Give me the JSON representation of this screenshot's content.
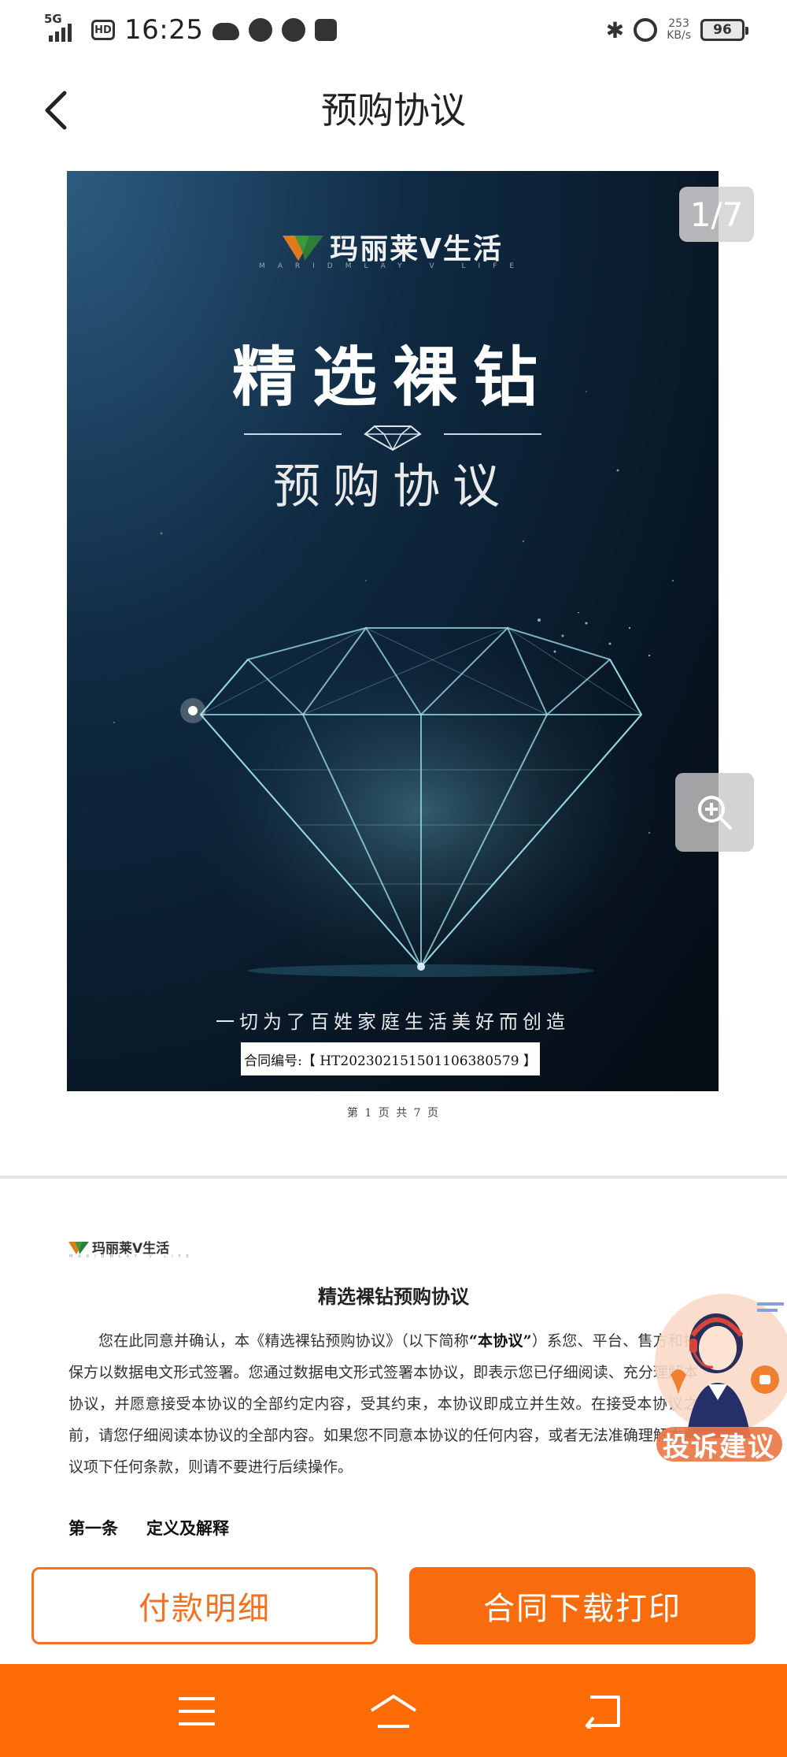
{
  "status_bar": {
    "network": "5G",
    "hd": "HD",
    "time": "16:25",
    "speed_value": "253",
    "speed_unit": "KB/s",
    "battery": "96",
    "icons": [
      "signal-icon",
      "weather-icon",
      "app-icon",
      "app-icon",
      "message-icon",
      "bluetooth-icon",
      "alarm-icon",
      "battery-icon"
    ]
  },
  "nav": {
    "title": "预购协议",
    "back_icon": "chevron-left-icon"
  },
  "cover": {
    "brand": "玛丽莱V生活",
    "brand_sub": "MARIDMLAY V LIFE",
    "title": "精选裸钻",
    "subtitle": "预购协议",
    "slogan": "一切为了百姓家庭生活美好而创造",
    "contract_label": "合同编号:【 HT2023021515011063805​79 】"
  },
  "viewer": {
    "page_indicator": "1/7",
    "page_footer": "第 1 页 共 7 页",
    "zoom_icon": "zoom-in-icon"
  },
  "page2": {
    "logo_text": "玛丽莱V生活",
    "logo_sub": "MARIDMLAY V LIFE",
    "title": "精选裸钻预购协议",
    "body_pre": "您在此同意并确认，本《精选裸钻预购协议》（以下简称",
    "body_bold": "“本协议”",
    "body_post": "）系您、平台、售方和担保方以数据电文形式签署。您通过数据电文形式签署本协议，即表示您已仔细阅读、充分理解本协议，并愿意接受本协议的全部约定内容，受其约束，本协议即成立并生效。在接受本协议之前，请您仔细阅读本协议的全部内容。如果您不同意本协议的任何内容，或者无法准确理解本协议项下任何条款，则请不要进行后续操作。",
    "section_num": "第一条",
    "section_title": "定义及解释"
  },
  "complaint": {
    "label": "投诉建议"
  },
  "actions": {
    "payment_details": "付款明细",
    "download_print": "合同下载打印"
  },
  "colors": {
    "accent": "#f86c0e",
    "nav_bar": "#ff6b05",
    "cover_bg": "#0a1a2a"
  }
}
